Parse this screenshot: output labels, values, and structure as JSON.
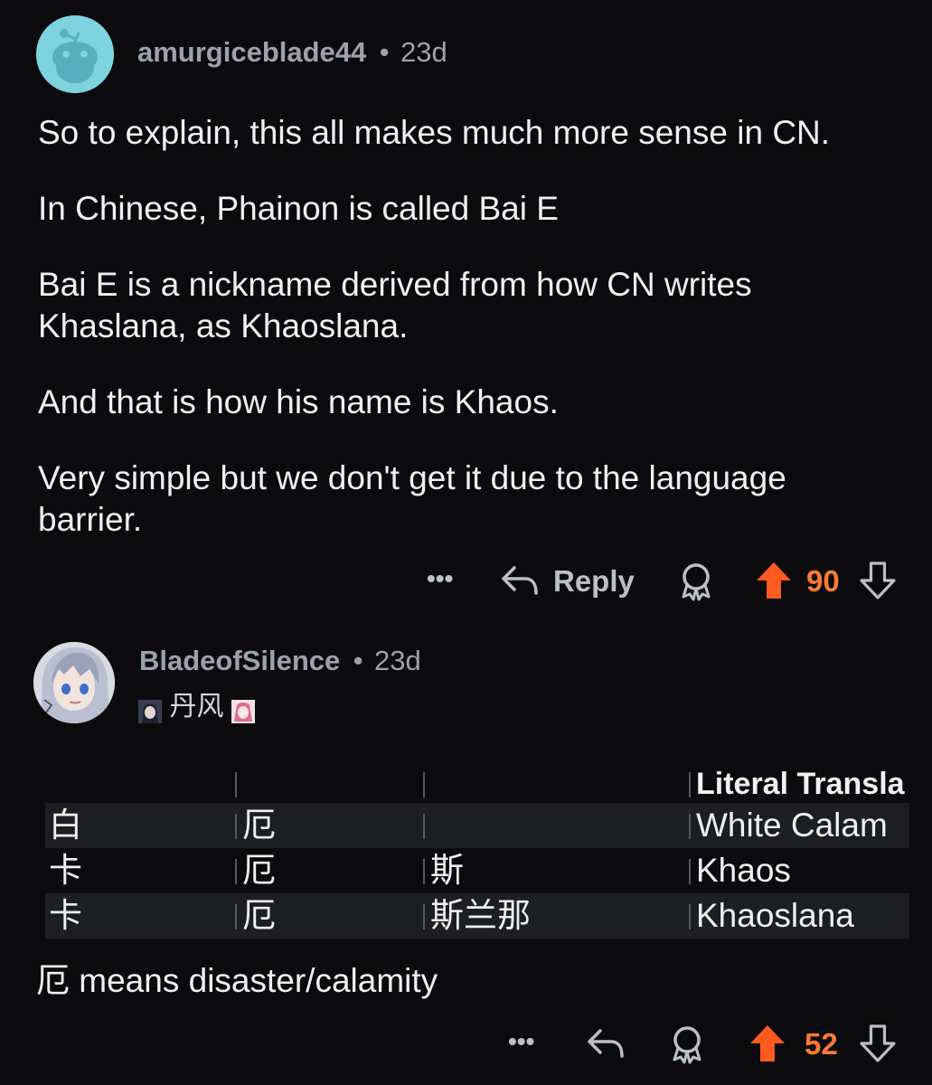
{
  "comments": [
    {
      "username": "amurgiceblade44",
      "separator": "•",
      "age": "23d",
      "paragraphs": [
        "So to explain, this all makes much more sense in CN.",
        "In Chinese, Phainon is called Bai E",
        "Bai E is a nickname derived from how CN writes Khaslana, as Khaoslana.",
        "And that is how his name is Khaos.",
        "Very simple but we don't get it due to the language barrier."
      ],
      "actions": {
        "more": "•••",
        "reply": "Reply",
        "upvotes": "90"
      }
    },
    {
      "username": "BladeofSilence",
      "separator": "•",
      "age": "23d",
      "flair": "丹风",
      "table": {
        "header": [
          "",
          "",
          "",
          "Literal Transla"
        ],
        "rows": [
          [
            "白",
            "厄",
            "",
            "White Calam"
          ],
          [
            "卡",
            "厄",
            "斯",
            "Khaos"
          ],
          [
            "卡",
            "厄",
            "斯兰那",
            "Khaoslana"
          ]
        ]
      },
      "footnote": "厄 means disaster/calamity",
      "actions": {
        "more": "•••",
        "upvotes": "52"
      }
    }
  ],
  "colors": {
    "upvote": "#ff5a1f",
    "background": "#0b0b0d",
    "muted": "#9aa3ab"
  }
}
